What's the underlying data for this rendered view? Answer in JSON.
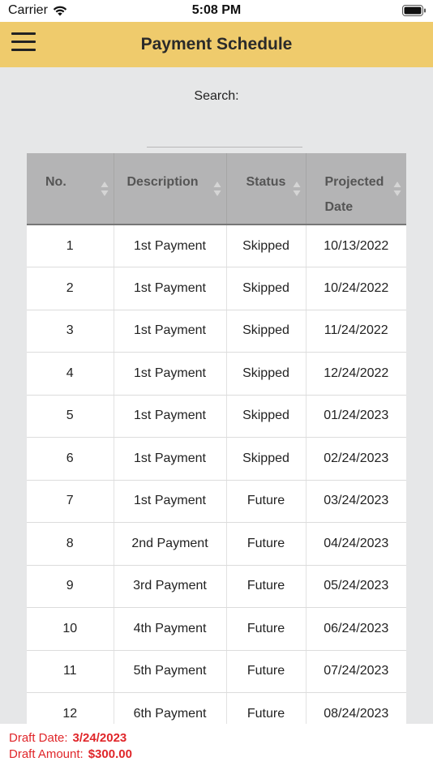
{
  "status_bar": {
    "carrier": "Carrier",
    "time": "5:08 PM"
  },
  "nav": {
    "title": "Payment Schedule"
  },
  "search": {
    "label": "Search:",
    "value": "",
    "placeholder": ""
  },
  "table": {
    "headers": [
      "No.",
      "Description",
      "Status",
      "Projected Date"
    ],
    "rows": [
      [
        "1",
        "1st Payment",
        "Skipped",
        "10/13/2022"
      ],
      [
        "2",
        "1st Payment",
        "Skipped",
        "10/24/2022"
      ],
      [
        "3",
        "1st Payment",
        "Skipped",
        "11/24/2022"
      ],
      [
        "4",
        "1st Payment",
        "Skipped",
        "12/24/2022"
      ],
      [
        "5",
        "1st Payment",
        "Skipped",
        "01/24/2023"
      ],
      [
        "6",
        "1st Payment",
        "Skipped",
        "02/24/2023"
      ],
      [
        "7",
        "1st Payment",
        "Future",
        "03/24/2023"
      ],
      [
        "8",
        "2nd Payment",
        "Future",
        "04/24/2023"
      ],
      [
        "9",
        "3rd Payment",
        "Future",
        "05/24/2023"
      ],
      [
        "10",
        "4th Payment",
        "Future",
        "06/24/2023"
      ],
      [
        "11",
        "5th Payment",
        "Future",
        "07/24/2023"
      ],
      [
        "12",
        "6th Payment",
        "Future",
        "08/24/2023"
      ]
    ]
  },
  "footer": {
    "draft_date_label": "Draft Date:",
    "draft_date_value": "3/24/2023",
    "draft_amount_label": "Draft Amount:",
    "draft_amount_value": "$300.00"
  },
  "colors": {
    "nav_bg": "#efcb6c",
    "footer_text": "#e0262a",
    "header_bg": "#b4b4b5",
    "page_bg": "#e6e7e8"
  },
  "icons": [
    "wifi-icon",
    "battery-icon",
    "hamburger-menu-icon",
    "sort-icon"
  ]
}
